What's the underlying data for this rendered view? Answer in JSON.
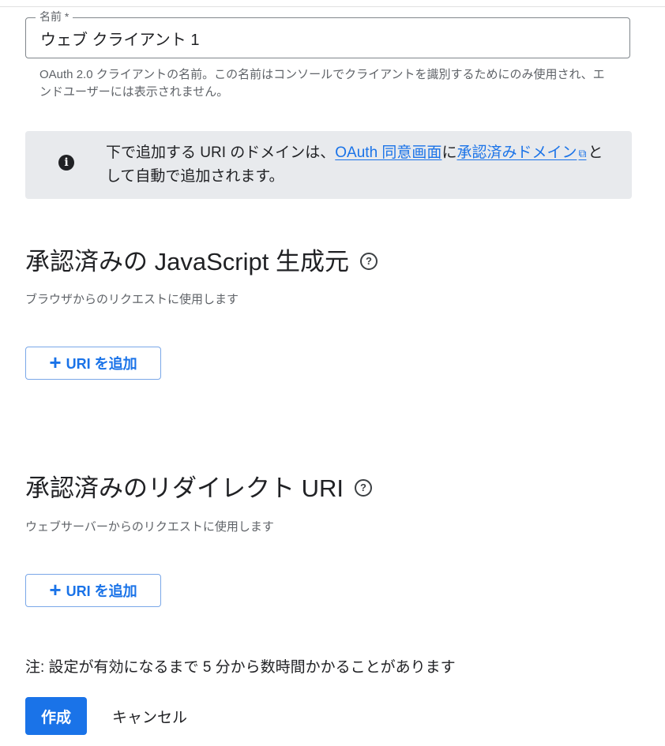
{
  "name_field": {
    "label": "名前 *",
    "value": "ウェブ クライアント 1",
    "helper": "OAuth 2.0 クライアントの名前。この名前はコンソールでクライアントを識別するためにのみ使用され、エンドユーザーには表示されません。"
  },
  "banner": {
    "text_before": "下で追加する URI のドメインは、",
    "link_consent": "OAuth 同意画面",
    "text_mid": "に",
    "link_domains": "承認済みドメイン",
    "text_after": "として自動で追加されます。"
  },
  "js_origins": {
    "title": "承認済みの JavaScript 生成元",
    "subtitle": "ブラウザからのリクエストに使用します",
    "add_label": "URI を追加"
  },
  "redirect_uris": {
    "title": "承認済みのリダイレクト URI",
    "subtitle": "ウェブサーバーからのリクエストに使用します",
    "add_label": "URI を追加"
  },
  "note": "注: 設定が有効になるまで 5 分から数時間かかることがあります",
  "actions": {
    "create": "作成",
    "cancel": "キャンセル"
  },
  "colors": {
    "accent": "#1a73e8",
    "banner_bg": "#e8eaed",
    "text": "#202124",
    "secondary_text": "#5f6368"
  },
  "icons": {
    "info": "info-icon",
    "help": "help-circle-icon",
    "external": "external-link-icon",
    "plus": "plus-icon"
  }
}
